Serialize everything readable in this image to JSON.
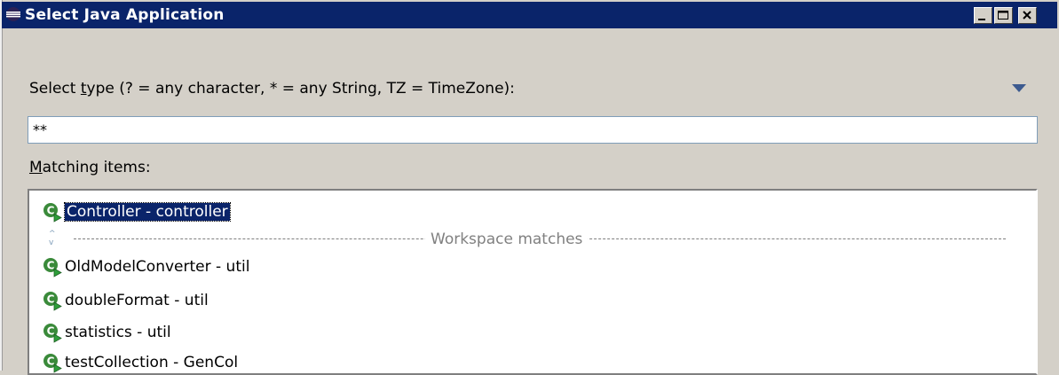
{
  "window": {
    "title": "Select Java Application"
  },
  "filter": {
    "label_prefix": "Select ",
    "label_mnemonic": "t",
    "label_suffix": "ype (? = any character, * = any String, TZ = TimeZone):",
    "value": "**"
  },
  "matching": {
    "label_mnemonic": "M",
    "label_suffix": "atching items:",
    "selected": {
      "label": "Controller - controller",
      "icon": "class-with-main-icon"
    },
    "separator_label": "Workspace matches",
    "items": [
      {
        "label": "OldModelConverter - util",
        "icon": "class-with-main-icon"
      },
      {
        "label": "doubleFormat - util",
        "icon": "class-with-main-icon"
      },
      {
        "label": "statistics - util",
        "icon": "class-with-main-icon"
      },
      {
        "label": "testCollection - GenCol",
        "icon": "class-with-main-icon"
      }
    ]
  },
  "colors": {
    "titlebar": "#0a246a",
    "selection": "#0a246a",
    "background": "#d4d0c8"
  }
}
